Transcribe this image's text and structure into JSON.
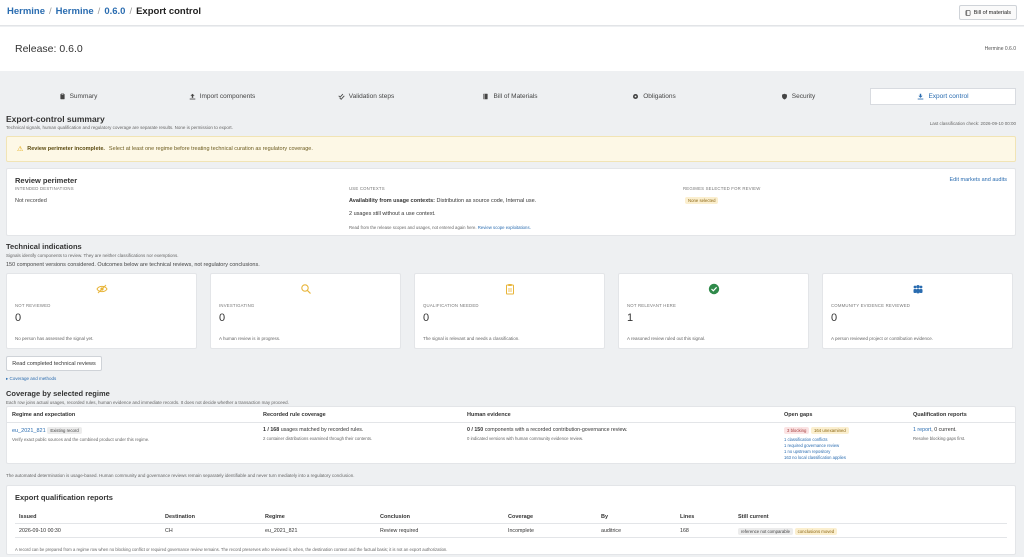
{
  "breadcrumb": {
    "items": [
      "Hermine",
      "Hermine",
      "0.6.0"
    ],
    "current": "Export control"
  },
  "toolbar": {
    "bom_label": "Bill of materials"
  },
  "release": {
    "title": "Release: 0.6.0",
    "product": "Hermine 0.6.0"
  },
  "tabs": [
    {
      "label": "Summary",
      "icon": "clipboard-icon"
    },
    {
      "label": "Import components",
      "icon": "upload-icon"
    },
    {
      "label": "Validation steps",
      "icon": "checks-icon"
    },
    {
      "label": "Bill of Materials",
      "icon": "book-icon"
    },
    {
      "label": "Obligations",
      "icon": "gear-icon"
    },
    {
      "label": "Security",
      "icon": "shield-icon"
    },
    {
      "label": "Export control",
      "icon": "download-icon",
      "active": true
    }
  ],
  "summary": {
    "title": "Export-control summary",
    "subtitle": "Technical signals, human qualification and regulatory coverage are separate results. None is permission to export.",
    "last_check": "Last classification check: 2026-09-10 00:00"
  },
  "warning": {
    "bold": "Review perimeter incomplete.",
    "text": "Select at least one regime before treating technical curation as regulatory coverage."
  },
  "perimeter": {
    "title": "Review perimeter",
    "edit_link": "Edit markets and audits",
    "dest_label": "Intended destinations",
    "dest_value": "Not recorded",
    "contexts_label": "Use contexts",
    "availability_bold": "Availability from usage contexts:",
    "availability_text": "Distribution as source code, Internal use.",
    "usages_without": "2 usages still without a use context.",
    "read_from": "Read from the release scopes and usages, not entered again here.",
    "review_link": "Review scope exploitations.",
    "regimes_label": "Regimes selected for review",
    "regimes_badge": "None selected"
  },
  "indications": {
    "title": "Technical indications",
    "subtitle": "Signals identify components to review. They are neither classifications nor exemptions.",
    "considered": "150 component versions considered. Outcomes below are technical reviews, not regulatory conclusions.",
    "kpis": [
      {
        "label": "Not reviewed",
        "value": "0",
        "desc": "No person has assessed the signal yet.",
        "icon": "eye-slash-icon",
        "color": "#e8b53a"
      },
      {
        "label": "Investigating",
        "value": "0",
        "desc": "A human review is in progress.",
        "icon": "magnifier-icon",
        "color": "#e8b53a"
      },
      {
        "label": "Qualification needed",
        "value": "0",
        "desc": "The signal is relevant and needs a classification.",
        "icon": "clipboard-icon",
        "color": "#e8b53a"
      },
      {
        "label": "Not relevant here",
        "value": "1",
        "desc": "A reasoned review ruled out this signal.",
        "icon": "check-circle-icon",
        "color": "#2f8a4a"
      },
      {
        "label": "Community evidence reviewed",
        "value": "0",
        "desc": "A person reviewed project or contribution evidence.",
        "icon": "people-icon",
        "color": "#2a6cb0"
      }
    ],
    "read_button": "Read completed technical reviews",
    "coverage_link": "▸ Coverage and methods"
  },
  "coverage": {
    "title": "Coverage by selected regime",
    "subtitle": "Each row joins actual usages, recorded rules, human evidence and immediate records. It does not decide whether a transaction may proceed.",
    "headers": [
      "Regime and expectation",
      "Recorded rule coverage",
      "Human evidence",
      "Open gaps",
      "Qualification reports"
    ],
    "row": {
      "regime": "eu_2021_821",
      "regime_badge": "Existing record",
      "regime_desc": "Verify exact public sources and the combined product under this regime.",
      "rule_bold": "1 / 168",
      "rule_text": "usages matched by recorded rules.",
      "rule_desc": "2 container distributions examined through their contents.",
      "human_bold": "0 / 150",
      "human_text": "components with a recorded contribution-governance review.",
      "human_desc": "0 indicated versions with human community evidence review.",
      "gap_badges": [
        "3 blocking",
        "164 unexamined"
      ],
      "gap_links": [
        "1 classification conflicts",
        "1 required governance review",
        "1 no upstream repository",
        "163 no local classification applies"
      ],
      "report_link": "1 report",
      "report_text": ", 0 current.",
      "report_desc": "Resolve blocking gaps first."
    },
    "footnote": "The automated determination is usage-based. Human community and governance reviews remain separately identifiable and never turn mediately into a regulatory conclusion."
  },
  "reports": {
    "title": "Export qualification reports",
    "headers": [
      "Issued",
      "Destination",
      "Regime",
      "Conclusion",
      "Coverage",
      "By",
      "Lines",
      "Still current"
    ],
    "rows": [
      {
        "issued": "2026-09-10 00:30",
        "destination": "CH",
        "regime": "eu_2021_821",
        "conclusion": "Review required",
        "coverage": "Incomplete",
        "by": "auditrice",
        "lines": "168",
        "badges": [
          "reference not comparable",
          "conclusions moved"
        ]
      }
    ],
    "footnote": "A record can be prepared from a regime row when no blocking conflict or required governance review remains. The record preserves who reviewed it, when, the destination context and the factual basis; it is not an export authorization."
  }
}
